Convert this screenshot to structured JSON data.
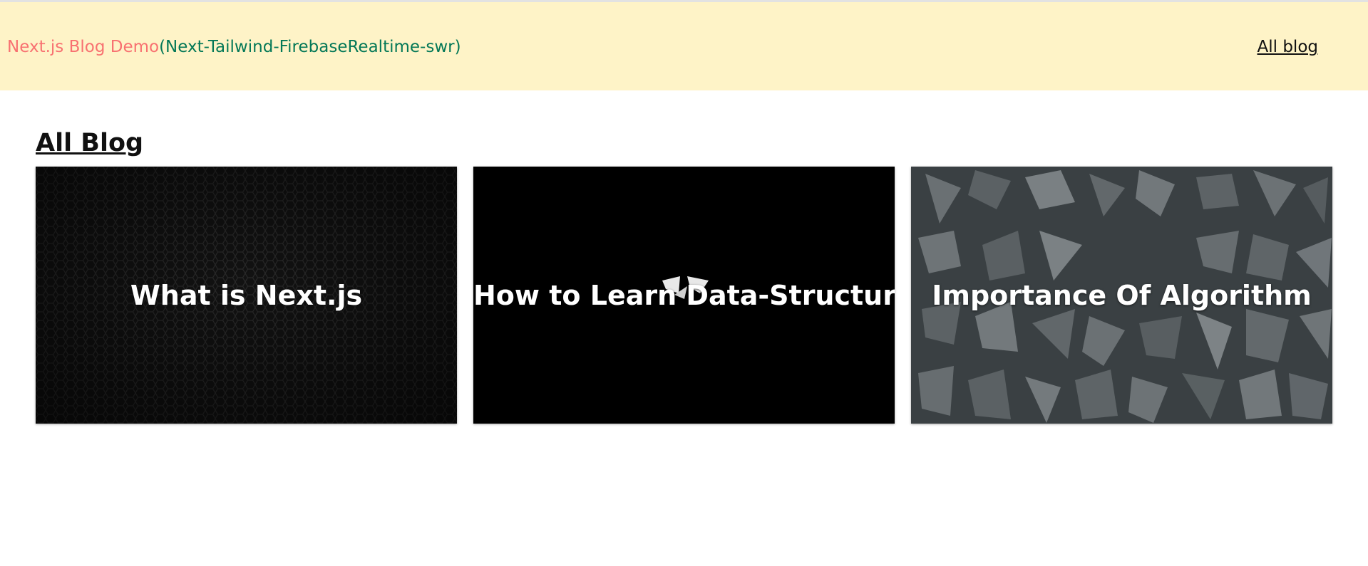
{
  "header": {
    "brand_main": "Next.js Blog Demo",
    "brand_sub": "(Next-Tailwind-FirebaseRealtime-swr)",
    "nav_link": "All blog",
    "colors": {
      "background": "#fef3c7",
      "brand_main": "#f87171",
      "brand_sub": "#047857"
    }
  },
  "main": {
    "title": "All Blog",
    "cards": [
      {
        "title": "What is Next.js",
        "image": "dark-hexagon-mesh-image"
      },
      {
        "title": "How to Learn Data-Structure",
        "image": "black-abstract-image"
      },
      {
        "title": "Importance Of Algorithm",
        "image": "gray-shattered-rocks-image"
      }
    ]
  }
}
